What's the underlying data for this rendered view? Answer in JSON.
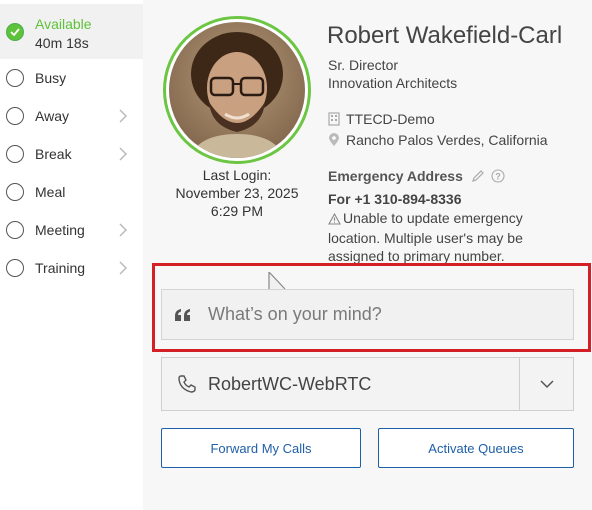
{
  "statuses": [
    {
      "label": "Available",
      "timer": "40m 18s",
      "active": true,
      "has_submenu": false
    },
    {
      "label": "Busy",
      "has_submenu": false
    },
    {
      "label": "Away",
      "has_submenu": true
    },
    {
      "label": "Break",
      "has_submenu": true
    },
    {
      "label": "Meal",
      "has_submenu": false
    },
    {
      "label": "Meeting",
      "has_submenu": true
    },
    {
      "label": "Training",
      "has_submenu": true
    }
  ],
  "profile": {
    "name": "Robert Wakefield-Carl",
    "title": "Sr. Director",
    "company": "Innovation Architects",
    "org": "TTECD-Demo",
    "location": "Rancho Palos Verdes, California",
    "last_login_label": "Last Login:",
    "last_login_date": "November 23, 2025",
    "last_login_time": "6:29 PM"
  },
  "emergency": {
    "heading": "Emergency Address",
    "phone": "For +1 310-894-8336",
    "warning": "Unable to update emergency location. Multiple user's may be assigned to primary number."
  },
  "post": {
    "placeholder": "What’s on your mind?"
  },
  "device": {
    "selected": "RobertWC-WebRTC"
  },
  "buttons": {
    "forward": "Forward My Calls",
    "queues": "Activate Queues"
  },
  "colors": {
    "available_green": "#5ec23a",
    "avatar_ring": "#6cc644",
    "button_blue": "#1f5fa8",
    "highlight_red": "#d51f26"
  },
  "icons": {
    "available": "check-icon",
    "submenu": "chevron-right-icon",
    "org": "building-icon",
    "location": "map-pin-icon",
    "edit": "pencil-icon",
    "help": "question-circle-icon",
    "warning": "warning-triangle-icon",
    "post": "quote-icon",
    "device": "phone-icon",
    "device_dropdown": "chevron-down-icon"
  }
}
